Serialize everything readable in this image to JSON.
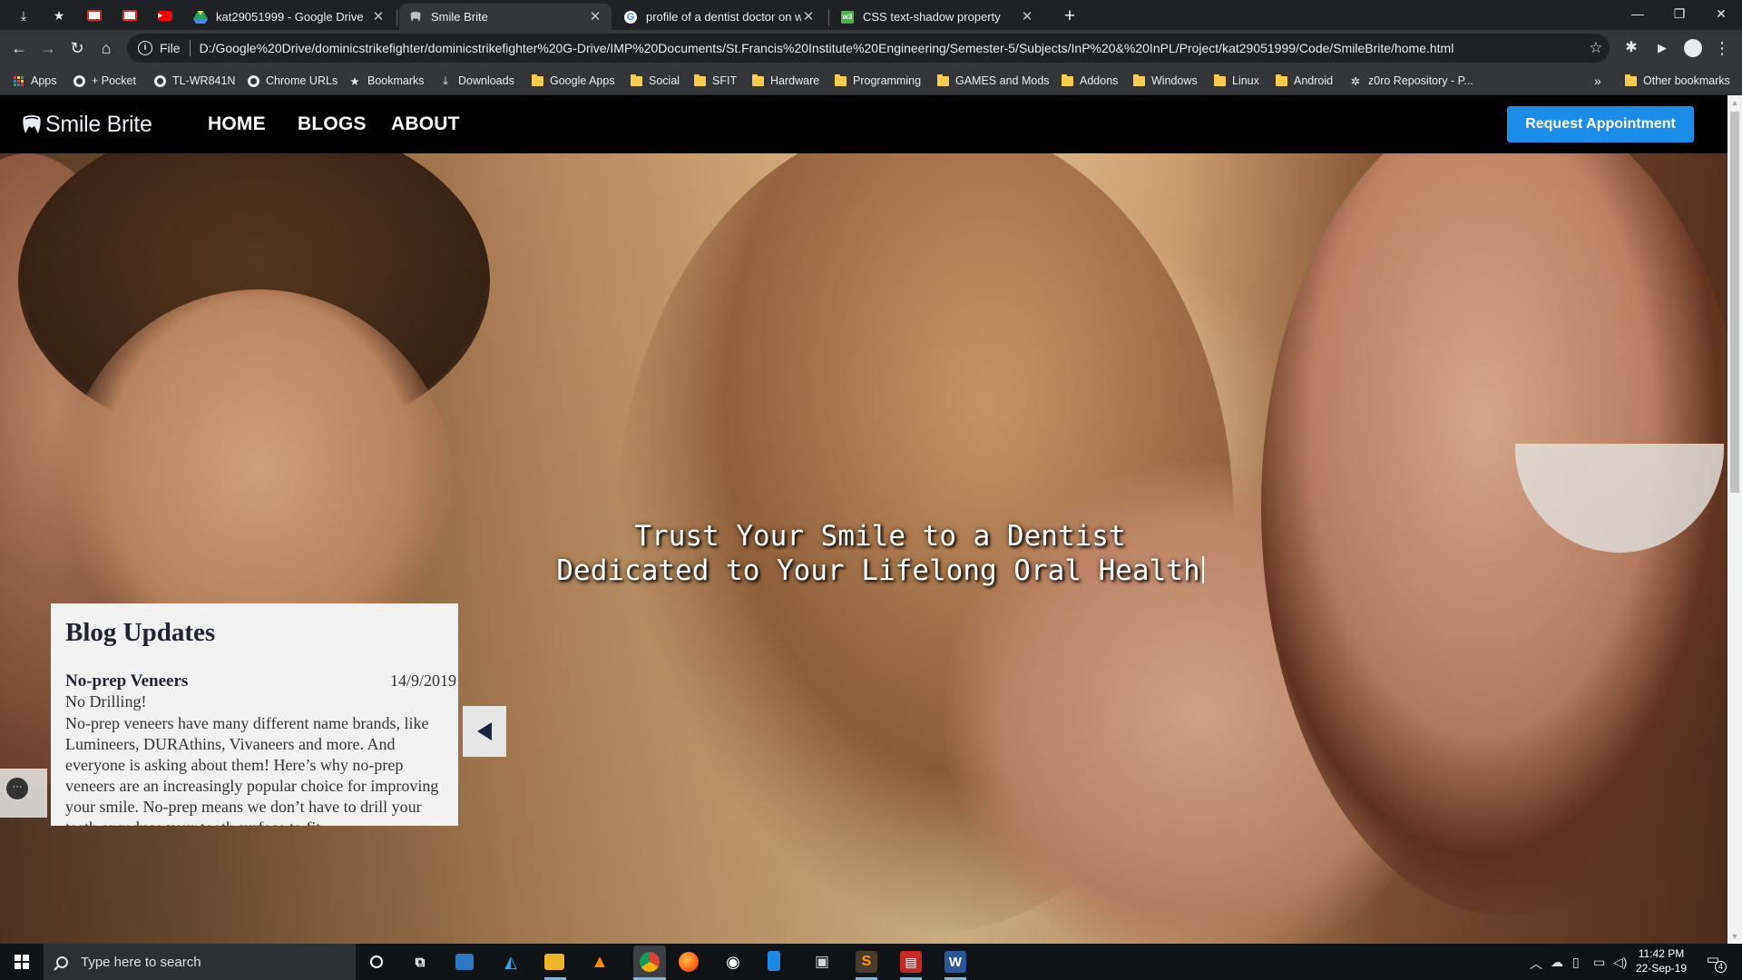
{
  "browser": {
    "pinned_tabs": [
      {
        "name": "downloads-icon",
        "glyph": "⤓"
      },
      {
        "name": "star-icon",
        "glyph": "★"
      },
      {
        "name": "gmail-icon",
        "glyph": "M"
      },
      {
        "name": "gmail-icon-2",
        "glyph": "M"
      },
      {
        "name": "youtube-icon",
        "glyph": "▶"
      }
    ],
    "tabs": [
      {
        "title": "kat29051999 - Google Drive",
        "icon": "google-drive-icon",
        "active": false
      },
      {
        "title": "Smile Brite",
        "icon": "tooth-icon",
        "active": true
      },
      {
        "title": "profile of a dentist doctor on wel",
        "icon": "google-icon",
        "active": false
      },
      {
        "title": "CSS text-shadow property",
        "icon": "w3schools-icon",
        "active": false
      }
    ],
    "new_tab_label": "+",
    "window_controls": {
      "minimize": "—",
      "restore": "❐",
      "close": "✕"
    },
    "address": {
      "scheme": "File",
      "url": "D:/Google%20Drive/dominicstrikefighter/dominicstrikefighter%20G-Drive/IMP%20Documents/St.Francis%20Institute%20Engineering/Semester-5/Subjects/InP%20&%20InPL/Project/kat29051999/Code/SmileBrite/home.html"
    },
    "bookmarks": [
      {
        "label": "Apps",
        "icon": "apps-grid-icon"
      },
      {
        "label": "+ Pocket",
        "icon": "globe-icon"
      },
      {
        "label": "TL-WR841N",
        "icon": "globe-icon"
      },
      {
        "label": "Chrome URLs",
        "icon": "globe-icon"
      },
      {
        "label": "Bookmarks",
        "icon": "star-icon"
      },
      {
        "label": "Downloads",
        "icon": "download-icon"
      },
      {
        "label": "Google Apps",
        "icon": "folder-icon"
      },
      {
        "label": "Social",
        "icon": "folder-icon"
      },
      {
        "label": "SFIT",
        "icon": "folder-icon"
      },
      {
        "label": "Hardware",
        "icon": "folder-icon"
      },
      {
        "label": "Programming",
        "icon": "folder-icon"
      },
      {
        "label": "GAMES and Mods",
        "icon": "folder-icon"
      },
      {
        "label": "Addons",
        "icon": "folder-icon"
      },
      {
        "label": "Windows",
        "icon": "folder-icon"
      },
      {
        "label": "Linux",
        "icon": "folder-icon"
      },
      {
        "label": "Android",
        "icon": "folder-icon"
      },
      {
        "label": "z0ro Repository - P...",
        "icon": "bug-icon"
      }
    ],
    "bookmarks_overflow": "»",
    "other_bookmarks": "Other bookmarks"
  },
  "site": {
    "logo_text": "Smile Brite",
    "nav": [
      "HOME",
      "BLOGS",
      "ABOUT"
    ],
    "cta": "Request Appointment",
    "tagline_line1": "Trust Your Smile to a Dentist",
    "tagline_line2": "Dedicated to Your Lifelong Oral Health",
    "blog": {
      "heading": "Blog Updates",
      "post_title": "No-prep Veneers",
      "post_date": "14/9/2019",
      "post_subtitle": "No Drilling!",
      "post_body": "No-prep veneers have many different name brands, like Lumineers, DURAthins, Vivaneers and more. And everyone is asking about them! Here’s why no-prep veneers are an increasingly popular choice for improving your smile. No-prep means we don’t have to drill your teeth or reduce your tooth surface to fit"
    },
    "chat_glyph": "···"
  },
  "taskbar": {
    "search_placeholder": "Type here to search",
    "time": "11:42 PM",
    "date": "22-Sep-19",
    "notification_count": "4"
  },
  "colors": {
    "cta_blue": "#1b8ce8",
    "nav_bg": "#000000",
    "chrome_dark": "#202124",
    "chrome_toolbar": "#35363a"
  }
}
